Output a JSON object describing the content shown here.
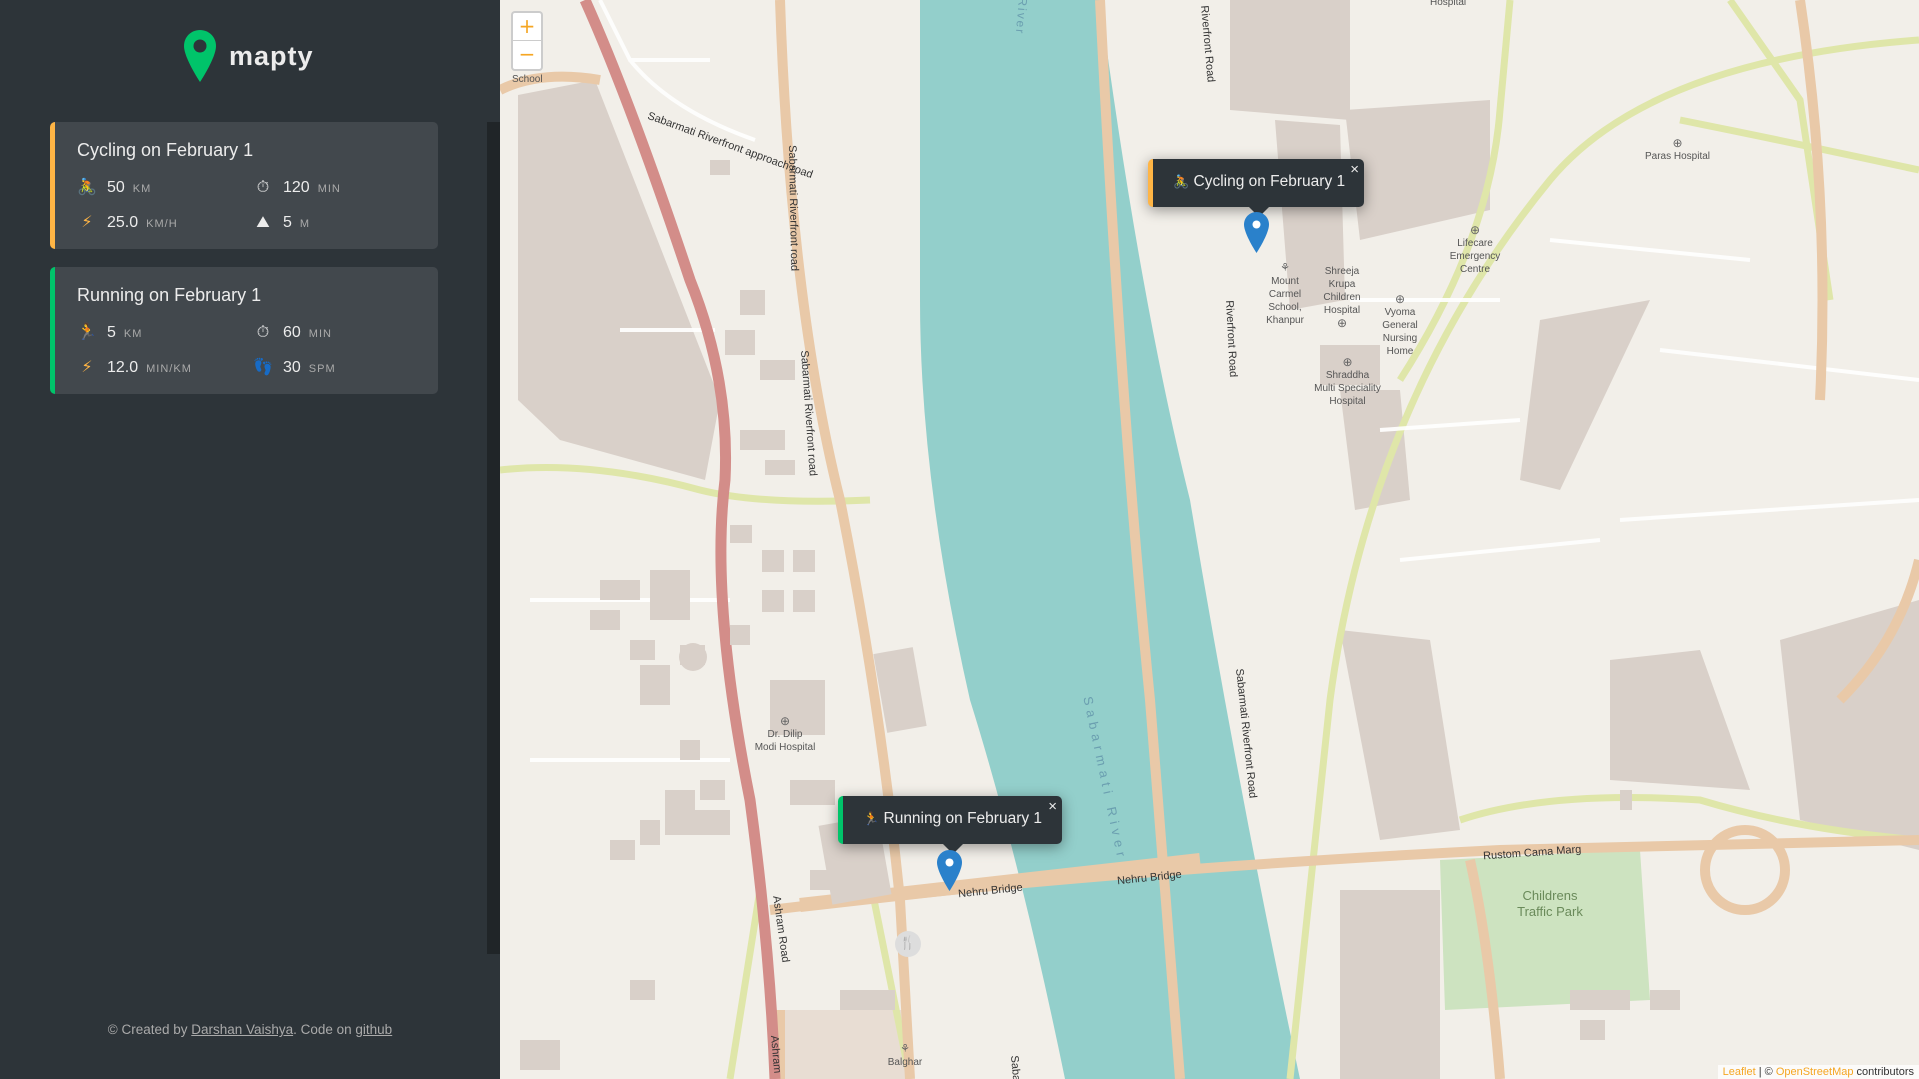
{
  "app": {
    "name": "mapty",
    "brand_color": "#00c46a"
  },
  "workouts": [
    {
      "type": "cycling",
      "title": "Cycling on February 1",
      "accent": "#ffb545",
      "details": [
        {
          "icon": "cyclist-icon",
          "glyph": "🚴",
          "value": "50",
          "unit": "KM"
        },
        {
          "icon": "stopwatch-icon",
          "glyph": "⏱",
          "value": "120",
          "unit": "MIN"
        },
        {
          "icon": "lightning-icon",
          "glyph": "⚡",
          "value": "25.0",
          "unit": "KM/H"
        },
        {
          "icon": "mountain-icon",
          "glyph": "⛰",
          "value": "5",
          "unit": "M"
        }
      ]
    },
    {
      "type": "running",
      "title": "Running on February 1",
      "accent": "#00c46a",
      "details": [
        {
          "icon": "runner-icon",
          "glyph": "🏃",
          "value": "5",
          "unit": "KM"
        },
        {
          "icon": "stopwatch-icon",
          "glyph": "⏱",
          "value": "60",
          "unit": "MIN"
        },
        {
          "icon": "lightning-icon",
          "glyph": "⚡",
          "value": "12.0",
          "unit": "MIN/KM"
        },
        {
          "icon": "footprint-icon",
          "glyph": "👣",
          "value": "30",
          "unit": "SPM"
        }
      ]
    }
  ],
  "footer": {
    "prefix": "© Created by",
    "author": "Darshan Vaishya",
    "middle": ". Code on",
    "code_link": "github"
  },
  "map": {
    "zoom_in": "+",
    "zoom_out": "−",
    "popups": [
      {
        "type": "cycling",
        "icon": "cyclist-icon",
        "glyph": "🚴",
        "text": "Cycling on February 1",
        "close": "×"
      },
      {
        "type": "running",
        "icon": "runner-icon",
        "glyph": "🏃",
        "text": "Running on February 1",
        "close": "×"
      }
    ],
    "labels": {
      "school_fragment": "School",
      "approach_road": "Sabarmati Riverfront approach road",
      "riverfront_road_west": "Sabarmati Riverfront road",
      "river": "Sabarmati River",
      "river_top": "River",
      "riverfront_road_east": "Riverfront Road",
      "riverfront_road_east_long": "Sabarmati Riverfront Road",
      "nehru_bridge": "Nehru Bridge",
      "rustom_cama": "Rustom Cama Marg",
      "ashram_road": "Ashram Road",
      "ashram_fragment": "Ashram",
      "dilip_hospital_1": "Dr. Dilip",
      "dilip_hospital_2": "Modi Hospital",
      "mount_carmel_1": "Mount",
      "mount_carmel_2": "Carmel",
      "mount_carmel_3": "School,",
      "mount_carmel_4": "Khanpur",
      "shreeja_1": "Shreeja",
      "shreeja_2": "Krupa",
      "shreeja_3": "Children",
      "shreeja_4": "Hospital",
      "shraddha_1": "Shraddha",
      "shraddha_2": "Multi Speciality",
      "shraddha_3": "Hospital",
      "vyoma_1": "Vyoma",
      "vyoma_2": "General",
      "vyoma_3": "Nursing",
      "vyoma_4": "Home",
      "lifecare_1": "Lifecare",
      "lifecare_2": "Emergency",
      "lifecare_3": "Centre",
      "paras_hospital": "Paras Hospital",
      "hospital_top": "Hospital",
      "childrens_park_1": "Childrens",
      "childrens_park_2": "Traffic Park",
      "balghar": "Balghar",
      "sabar_fragment": "Saba"
    },
    "attribution": {
      "leaflet": "Leaflet",
      "sep": " | © ",
      "osm": "OpenStreetMap",
      "suffix": " contributors"
    },
    "colors": {
      "land": "#f2efe9",
      "water": "#aad3df",
      "river": "#93cfcb",
      "residential": "#d9d0c9",
      "major_road": "#d38d89",
      "secondary_road": "#e9c9a8",
      "tertiary_road": "#dfe6a9",
      "park": "#cde3c0",
      "building": "#d9d0c9",
      "marker": "#2a81cb"
    }
  }
}
